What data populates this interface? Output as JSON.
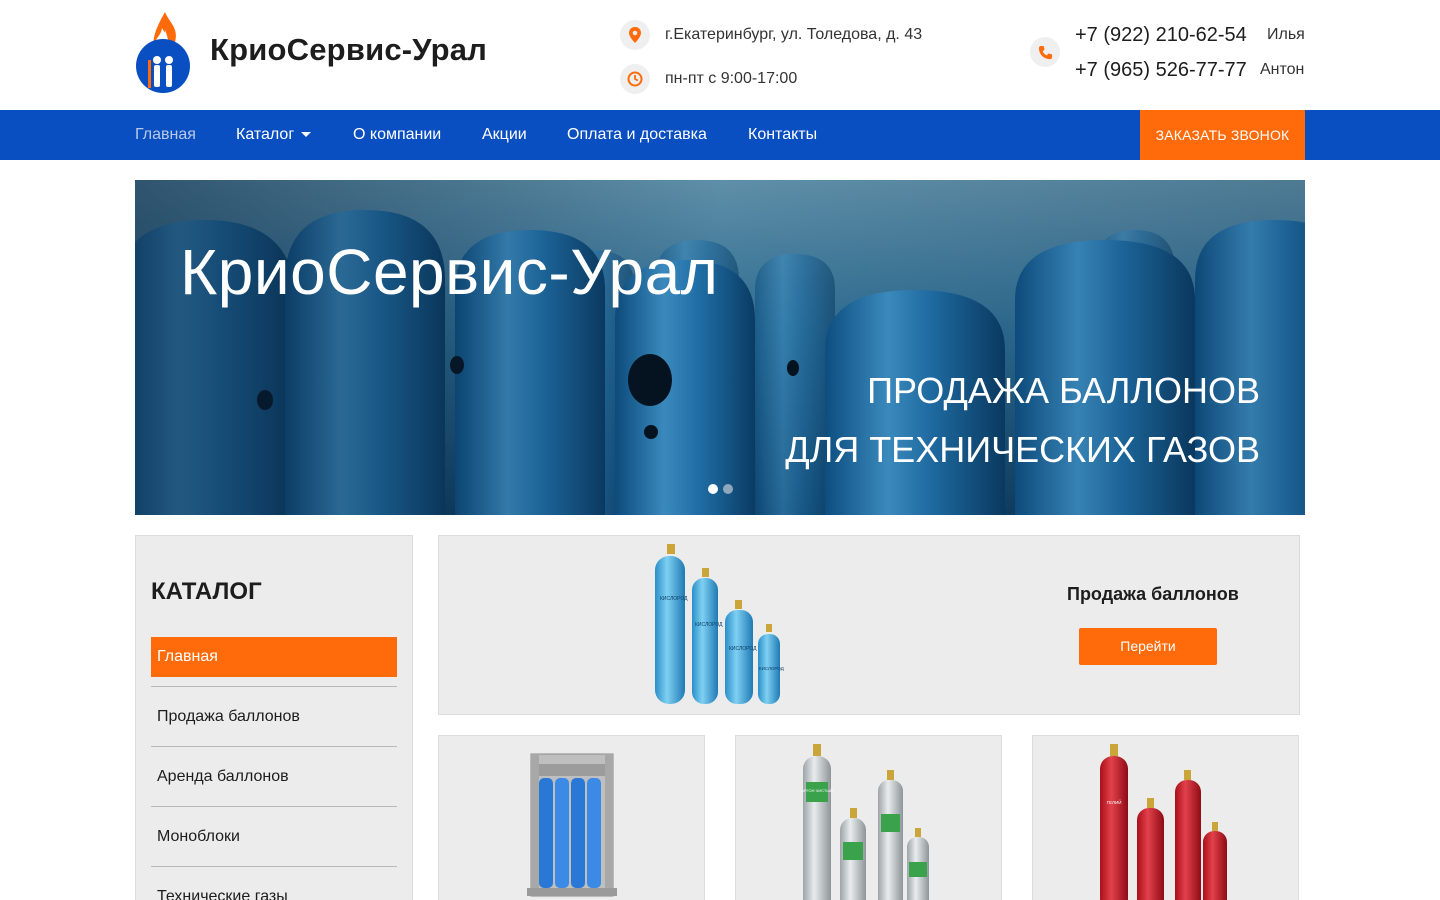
{
  "header": {
    "brand": "КриоСервис-Урал",
    "address": "г.Екатеринбург, ул. Толедова, д. 43",
    "hours": "пн-пт с 9:00-17:00",
    "phones": [
      {
        "number": "+7 (922) 210-62-54",
        "name": "Илья"
      },
      {
        "number": "+7 (965) 526-77-77",
        "name": "Антон"
      }
    ]
  },
  "nav": {
    "items": [
      "Главная",
      "Каталог",
      "О компании",
      "Акции",
      "Оплата и доставка",
      "Контакты"
    ],
    "cta": "ЗАКАЗАТЬ ЗВОНОК"
  },
  "hero": {
    "title": "КриоСервис-Урал",
    "subtitle_line1": "ПРОДАЖА БАЛЛОНОВ",
    "subtitle_line2": "ДЛЯ ТЕХНИЧЕСКИХ ГАЗОВ",
    "slides": 2,
    "active_slide": 1
  },
  "sidebar": {
    "title": "КАТАЛОГ",
    "items": [
      "Главная",
      "Продажа баллонов",
      "Аренда баллонов",
      "Моноблоки",
      "Технические газы"
    ]
  },
  "featured": {
    "title": "Продажа баллонов",
    "button": "Перейти",
    "cylinder_labels": [
      "КИСЛОРОД"
    ]
  },
  "cards": [
    {
      "image": "monoblock"
    },
    {
      "image": "argon-cylinders",
      "cylinder_labels": [
        "АРГОН ЧИСТЫЙ"
      ]
    },
    {
      "image": "helium-cylinders",
      "cylinder_labels": [
        "ГЕЛИЙ"
      ]
    }
  ],
  "colors": {
    "nav": "#0a4fc2",
    "accent": "#ff6b0a",
    "card_bg": "#ececec"
  }
}
